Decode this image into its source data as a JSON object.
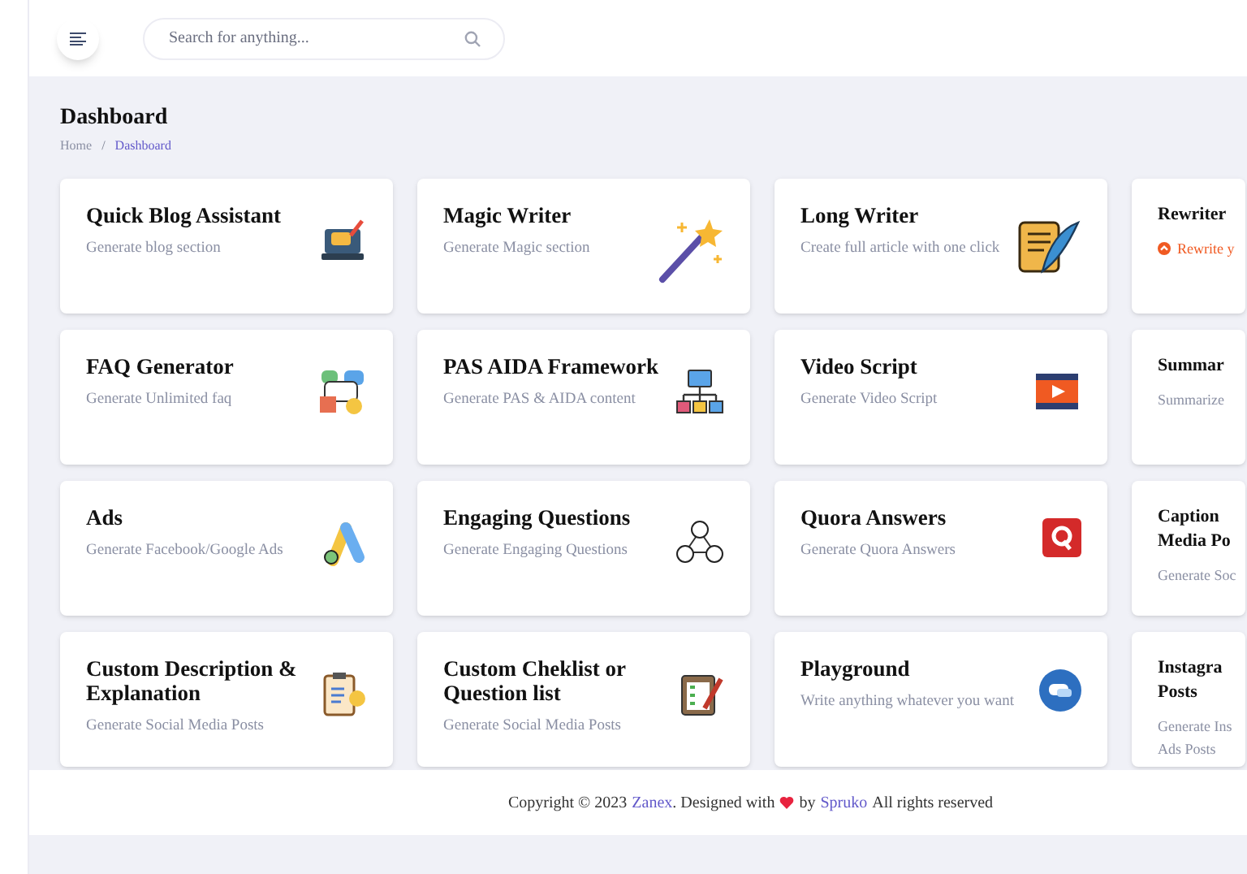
{
  "header": {
    "search": {
      "placeholder": "Search for anything..."
    }
  },
  "page": {
    "title": "Dashboard",
    "breadcrumb_separator": "/",
    "breadcrumb": [
      {
        "label": "Home",
        "selected": false
      },
      {
        "label": "Dashboard",
        "selected": true
      }
    ]
  },
  "cards": [
    {
      "title": "Quick Blog Assistant",
      "description": "Generate blog section",
      "highlighted": false
    },
    {
      "title": "Magic Writer",
      "description": "Generate Magic section",
      "highlighted": false
    },
    {
      "title": "Long Writer",
      "description": "Create full article with one click",
      "highlighted": false
    },
    {
      "title": "Rewriter",
      "description": "Rewrite y",
      "highlighted": true
    },
    {
      "title": "FAQ Generator",
      "description": "Generate Unlimited faq",
      "highlighted": false
    },
    {
      "title": "PAS AIDA Framework",
      "description": "Generate PAS & AIDA content",
      "highlighted": false
    },
    {
      "title": "Video Script",
      "description": "Generate Video Script",
      "highlighted": false
    },
    {
      "title": "Summar",
      "description": "Summarize",
      "highlighted": false
    },
    {
      "title": "Ads",
      "description": "Generate Facebook/Google Ads",
      "highlighted": false
    },
    {
      "title": "Engaging Questions",
      "description": "Generate Engaging Questions",
      "highlighted": false
    },
    {
      "title": "Quora Answers",
      "description": "Generate Quora Answers",
      "highlighted": false
    },
    {
      "title": "Caption Media Po",
      "description": "Generate Soc",
      "highlighted": false
    },
    {
      "title": "Custom Description & Explanation",
      "description": "Generate Social Media Posts",
      "highlighted": false
    },
    {
      "title": "Custom Cheklist or Question list",
      "description": "Generate Social Media Posts",
      "highlighted": false
    },
    {
      "title": "Playground",
      "description": "Write anything whatever you want",
      "highlighted": false
    },
    {
      "title": "Instagra Posts",
      "description": "Generate Ins Ads Posts",
      "highlighted": false
    }
  ],
  "footer": {
    "prefix": "Copyright © 2023",
    "brand": "Zanex",
    "middle": ". Designed with",
    "by": "by",
    "author": "Spruko",
    "suffix": "All rights reserved"
  }
}
